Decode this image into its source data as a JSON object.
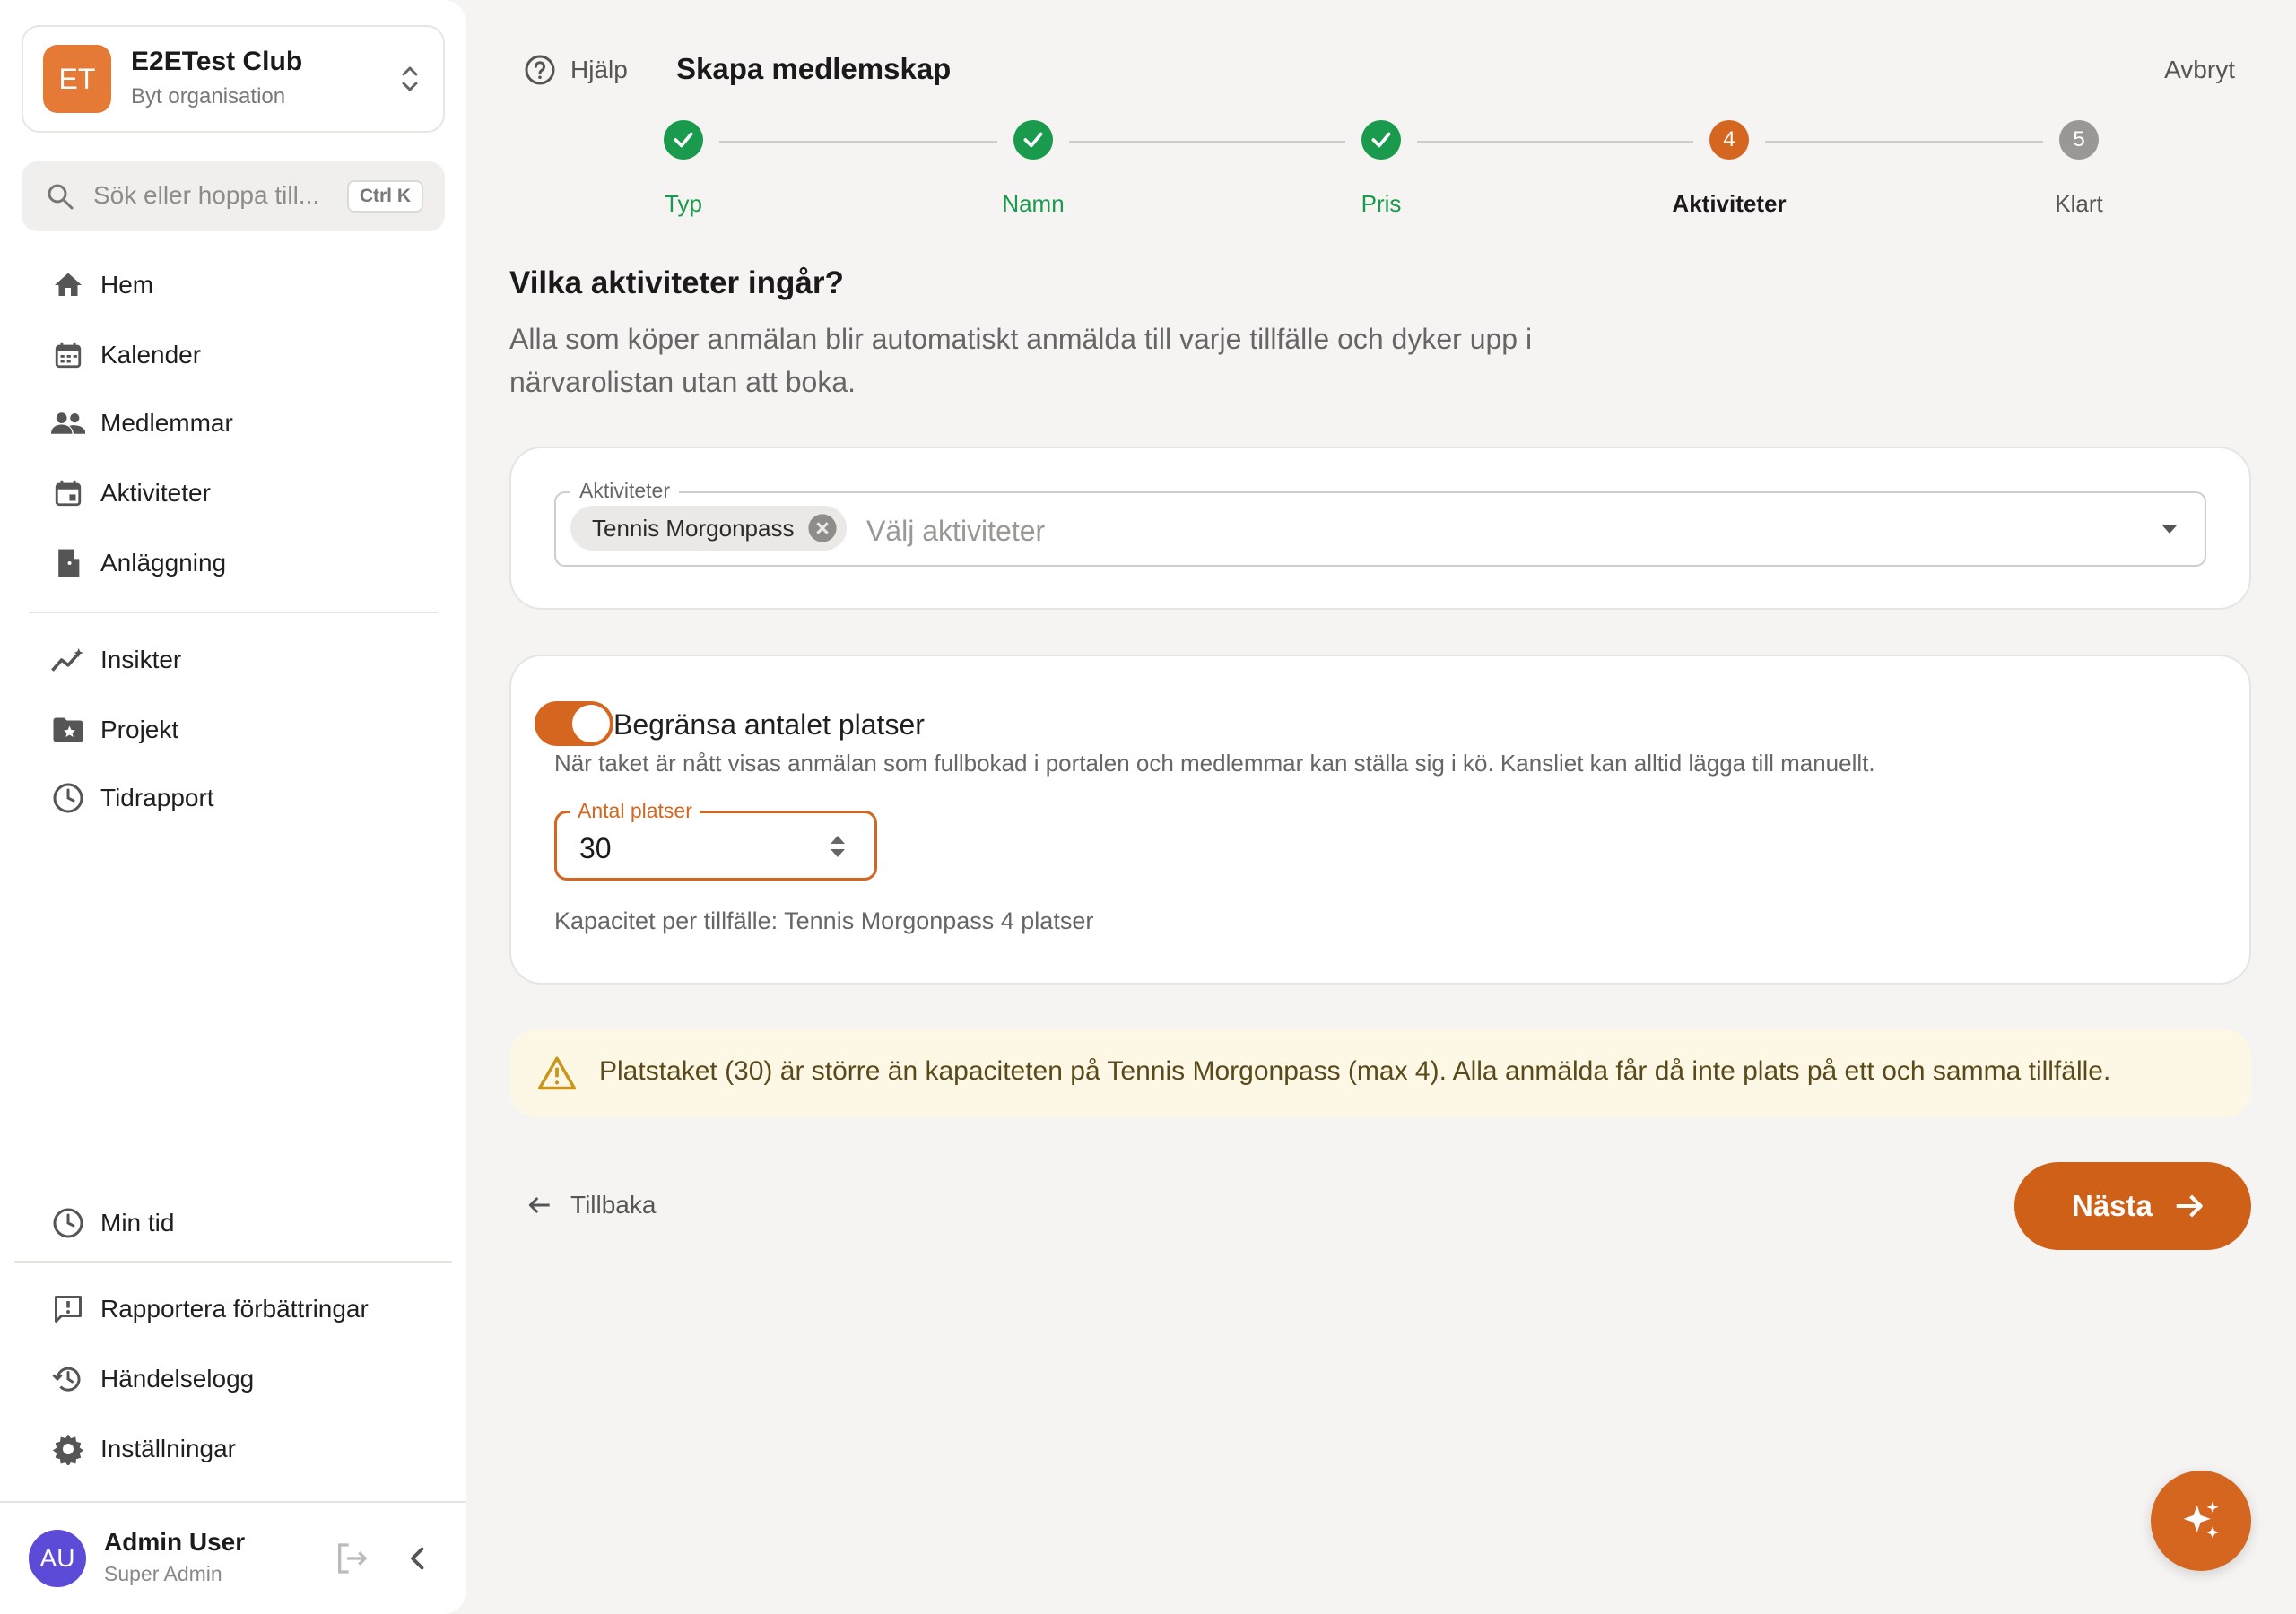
{
  "sidebar": {
    "org": {
      "initials": "ET",
      "name": "E2ETest Club",
      "subtitle": "Byt organisation"
    },
    "search": {
      "placeholder": "Sök eller hoppa till...",
      "shortcut": "Ctrl K"
    },
    "nav_main": [
      {
        "label": "Hem",
        "icon": "home-icon"
      },
      {
        "label": "Kalender",
        "icon": "calendar-icon"
      },
      {
        "label": "Medlemmar",
        "icon": "people-icon"
      },
      {
        "label": "Aktiviteter",
        "icon": "event-icon"
      },
      {
        "label": "Anläggning",
        "icon": "door-icon"
      }
    ],
    "nav_secondary": [
      {
        "label": "Insikter",
        "icon": "insights-icon"
      },
      {
        "label": "Projekt",
        "icon": "folder-star-icon"
      },
      {
        "label": "Tidrapport",
        "icon": "clock-icon"
      }
    ],
    "nav_bottom": [
      {
        "label": "Min tid",
        "icon": "clock-icon"
      },
      {
        "label": "Rapportera förbättringar",
        "icon": "feedback-icon"
      },
      {
        "label": "Händelselogg",
        "icon": "history-icon"
      },
      {
        "label": "Inställningar",
        "icon": "gear-icon"
      }
    ],
    "user": {
      "initials": "AU",
      "name": "Admin User",
      "role": "Super Admin"
    }
  },
  "header": {
    "help_label": "Hjälp",
    "title": "Skapa medlemskap",
    "cancel_label": "Avbryt"
  },
  "stepper": {
    "steps": [
      {
        "label": "Typ",
        "state": "done",
        "number": "1"
      },
      {
        "label": "Namn",
        "state": "done",
        "number": "2"
      },
      {
        "label": "Pris",
        "state": "done",
        "number": "3"
      },
      {
        "label": "Aktiviteter",
        "state": "active",
        "number": "4"
      },
      {
        "label": "Klart",
        "state": "pending",
        "number": "5"
      }
    ]
  },
  "question": {
    "title": "Vilka aktiviteter ingår?",
    "description": "Alla som köper anmälan blir automatiskt anmälda till varje tillfälle och dyker upp i närvarolistan utan att boka."
  },
  "activities_field": {
    "label": "Aktiviteter",
    "selected_chip": "Tennis Morgonpass",
    "placeholder": "Välj aktiviteter"
  },
  "limit": {
    "toggle_on": true,
    "toggle_label": "Begränsa antalet platser",
    "help": "När taket är nått visas anmälan som fullbokad i portalen och medlemmar kan ställa sig i kö. Kansliet kan alltid lägga till manuellt.",
    "field_label": "Antal platser",
    "value": "30",
    "capacity_text": "Kapacitet per tillfälle: Tennis Morgonpass 4 platser"
  },
  "warning": {
    "text": "Platstaket (30) är större än kapaciteten på Tennis Morgonpass (max 4). Alla anmälda får då inte plats på ett och samma tillfälle."
  },
  "footer": {
    "back_label": "Tillbaka",
    "next_label": "Nästa"
  },
  "colors": {
    "accent": "#d4661f",
    "success": "#1a9a4c",
    "warning_bg": "#fdf7e6",
    "warning_icon": "#c8961a"
  }
}
